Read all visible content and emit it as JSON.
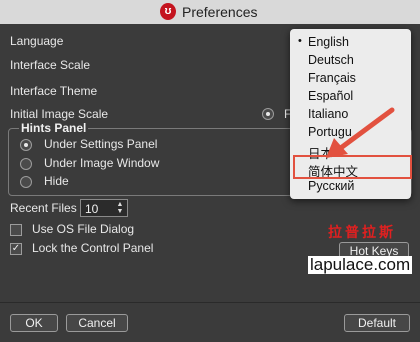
{
  "window": {
    "title": "Preferences"
  },
  "labels": {
    "language": "Language",
    "interface_scale": "Interface Scale",
    "interface_theme": "Interface Theme",
    "initial_image_scale": "Initial Image Scale",
    "initial_image_scale_option_partial": "F",
    "recent_files": "Recent Files",
    "use_os_file_dialog": "Use OS File Dialog",
    "lock_control_panel": "Lock the Control Panel"
  },
  "hints_panel": {
    "title": "Hints Panel",
    "options": [
      {
        "label": "Under Settings Panel",
        "selected": true
      },
      {
        "label": "Under Image Window",
        "selected": false
      },
      {
        "label": "Hide",
        "selected": false
      }
    ]
  },
  "recent_files": {
    "value": "10"
  },
  "checkboxes": {
    "use_os_file_dialog": false,
    "lock_control_panel": true
  },
  "buttons": {
    "hot_keys": "Hot Keys",
    "ok": "OK",
    "cancel": "Cancel",
    "default": "Default"
  },
  "language_menu": {
    "selected": "English",
    "bullet": "•",
    "items": [
      "English",
      "Deutsch",
      "Français",
      "Español",
      "Italiano",
      "Português",
      "日本語",
      "简体中文",
      "Русский"
    ],
    "visible_text": [
      "English",
      "Deutsch",
      "Français",
      "Español",
      "Italiano",
      "Portugu",
      "日本",
      "简体中文",
      "Русский"
    ]
  },
  "watermark": {
    "cn": "拉普拉斯",
    "url": "lapulace.com"
  },
  "colors": {
    "annotation": "#e2513f",
    "watermark_red": "#e02020"
  }
}
